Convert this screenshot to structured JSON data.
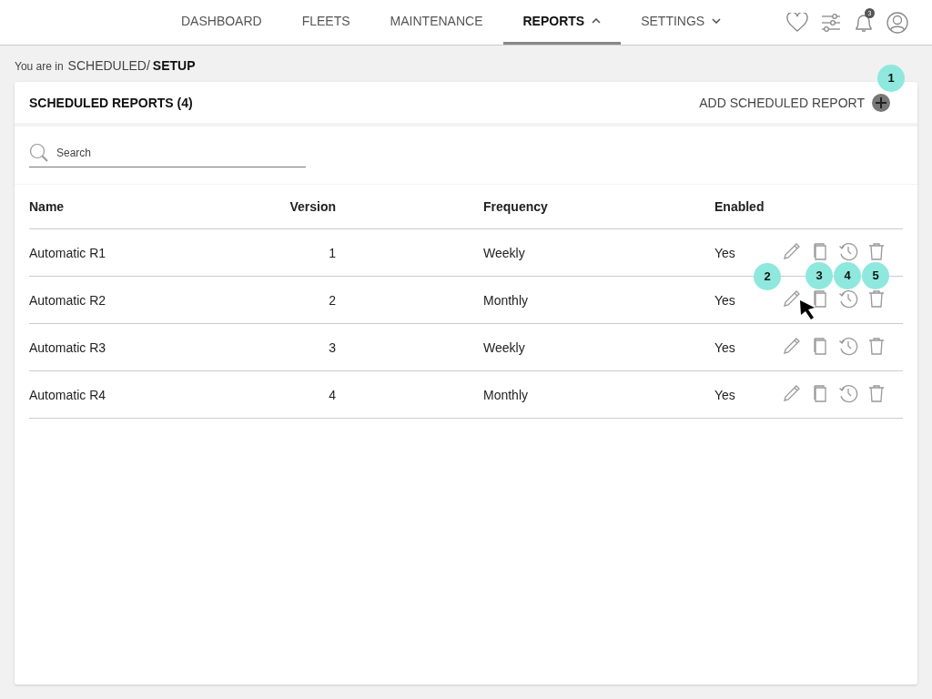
{
  "nav": {
    "tabs": [
      {
        "label": "DASHBOARD",
        "selected": false,
        "menu": false
      },
      {
        "label": "FLEETS",
        "selected": false,
        "menu": false
      },
      {
        "label": "MAINTENANCE",
        "selected": false,
        "menu": false
      },
      {
        "label": "REPORTS",
        "selected": true,
        "menu": true,
        "expanded": true
      },
      {
        "label": "SETTINGS",
        "selected": false,
        "menu": true,
        "expanded": false
      }
    ],
    "notification_count": "3"
  },
  "breadcrumb": {
    "prefix": "You are in",
    "path": "SCHEDULED/",
    "current": "SETUP"
  },
  "panel": {
    "title": "SCHEDULED REPORTS (4)",
    "add_button": {
      "label": "ADD SCHEDULED REPORT",
      "callout": "1"
    },
    "search": {
      "placeholder": "Search"
    },
    "columns": [
      "Name",
      "Version",
      "Frequency",
      "Enabled"
    ],
    "rows": [
      {
        "name": "Automatic R1",
        "version": "1",
        "frequency": "Weekly",
        "enabled": "Yes",
        "callouts": {
          "copy": "3",
          "history": "4",
          "delete": "5"
        },
        "pointer": false
      },
      {
        "name": "Automatic R2",
        "version": "2",
        "frequency": "Monthly",
        "enabled": "Yes",
        "callouts": {
          "edit": "2"
        },
        "pointer": true
      },
      {
        "name": "Automatic R3",
        "version": "3",
        "frequency": "Weekly",
        "enabled": "Yes",
        "callouts": {},
        "pointer": false
      },
      {
        "name": "Automatic R4",
        "version": "4",
        "frequency": "Monthly",
        "enabled": "Yes",
        "callouts": {},
        "pointer": false
      }
    ]
  }
}
